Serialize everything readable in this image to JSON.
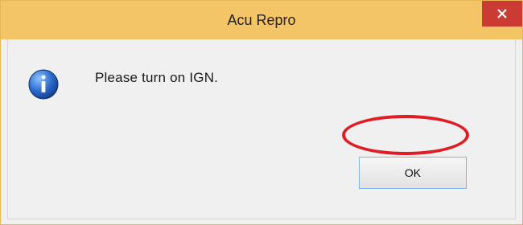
{
  "window": {
    "title": "Acu Repro",
    "close_label": "×"
  },
  "dialog": {
    "icon": "info-icon",
    "message": "Please turn on IGN.",
    "ok_label": "OK"
  },
  "colors": {
    "titlebar": "#f4c567",
    "close_button": "#cc3b33",
    "highlight": "#e01c24",
    "background": "#f0f0f0"
  }
}
